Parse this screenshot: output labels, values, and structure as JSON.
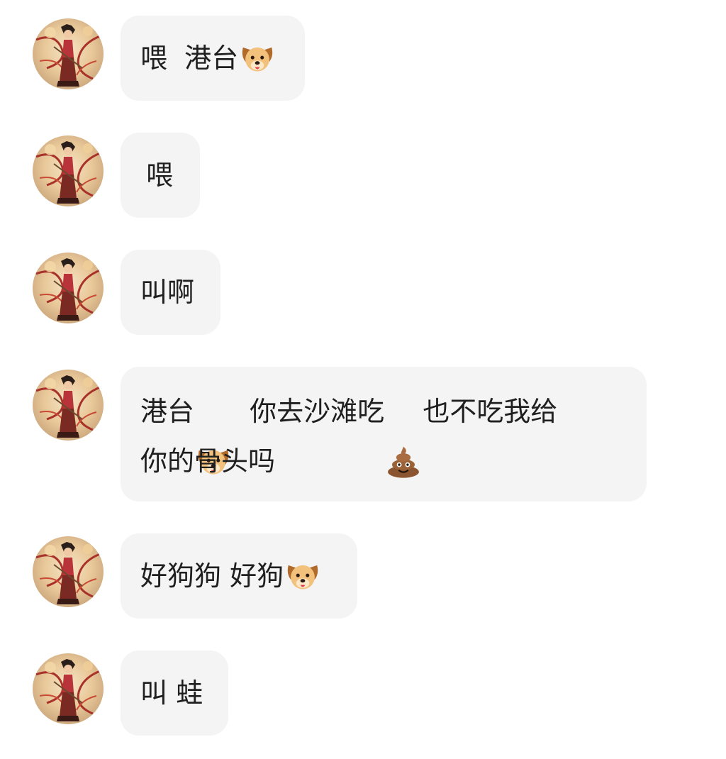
{
  "chat": {
    "messages": [
      {
        "segments": [
          {
            "text": "喂  港台"
          },
          {
            "emoji": "dog-face"
          }
        ]
      },
      {
        "segments": [
          {
            "text": "喂"
          }
        ]
      },
      {
        "segments": [
          {
            "text": "叫啊"
          }
        ]
      },
      {
        "segments": [
          {
            "text": "港台"
          },
          {
            "emoji": "dog-face"
          },
          {
            "text": "  你去沙滩吃"
          },
          {
            "emoji": "pile-of-poo"
          },
          {
            "text": "也不吃我给\n你的骨头吗"
          }
        ]
      },
      {
        "segments": [
          {
            "text": "好狗狗 好狗"
          },
          {
            "emoji": "dog-face"
          }
        ]
      },
      {
        "segments": [
          {
            "text": "叫 蛙"
          }
        ]
      }
    ]
  },
  "colors": {
    "bubble_background": "#f4f4f4",
    "text": "#1f1f1f",
    "page_background": "#ffffff"
  }
}
